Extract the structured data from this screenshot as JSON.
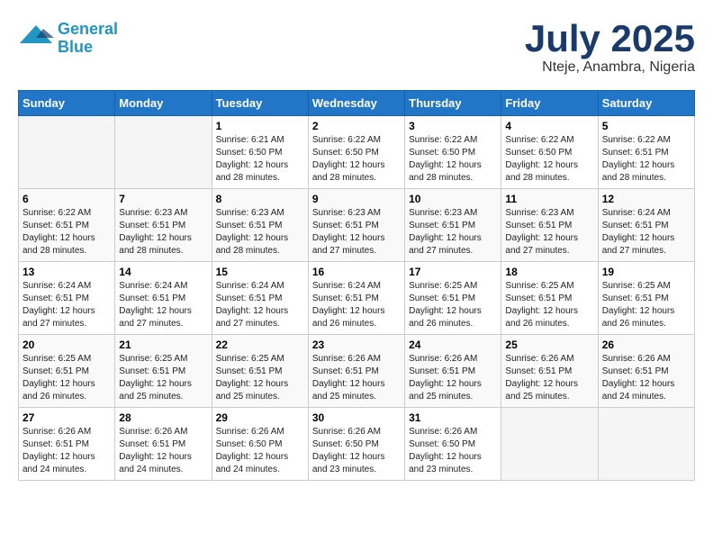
{
  "header": {
    "logo_line1": "General",
    "logo_line2": "Blue",
    "month": "July 2025",
    "location": "Nteje, Anambra, Nigeria"
  },
  "weekdays": [
    "Sunday",
    "Monday",
    "Tuesday",
    "Wednesday",
    "Thursday",
    "Friday",
    "Saturday"
  ],
  "weeks": [
    [
      {
        "day": "",
        "sunrise": "",
        "sunset": "",
        "daylight": ""
      },
      {
        "day": "",
        "sunrise": "",
        "sunset": "",
        "daylight": ""
      },
      {
        "day": "1",
        "sunrise": "Sunrise: 6:21 AM",
        "sunset": "Sunset: 6:50 PM",
        "daylight": "Daylight: 12 hours and 28 minutes."
      },
      {
        "day": "2",
        "sunrise": "Sunrise: 6:22 AM",
        "sunset": "Sunset: 6:50 PM",
        "daylight": "Daylight: 12 hours and 28 minutes."
      },
      {
        "day": "3",
        "sunrise": "Sunrise: 6:22 AM",
        "sunset": "Sunset: 6:50 PM",
        "daylight": "Daylight: 12 hours and 28 minutes."
      },
      {
        "day": "4",
        "sunrise": "Sunrise: 6:22 AM",
        "sunset": "Sunset: 6:50 PM",
        "daylight": "Daylight: 12 hours and 28 minutes."
      },
      {
        "day": "5",
        "sunrise": "Sunrise: 6:22 AM",
        "sunset": "Sunset: 6:51 PM",
        "daylight": "Daylight: 12 hours and 28 minutes."
      }
    ],
    [
      {
        "day": "6",
        "sunrise": "Sunrise: 6:22 AM",
        "sunset": "Sunset: 6:51 PM",
        "daylight": "Daylight: 12 hours and 28 minutes."
      },
      {
        "day": "7",
        "sunrise": "Sunrise: 6:23 AM",
        "sunset": "Sunset: 6:51 PM",
        "daylight": "Daylight: 12 hours and 28 minutes."
      },
      {
        "day": "8",
        "sunrise": "Sunrise: 6:23 AM",
        "sunset": "Sunset: 6:51 PM",
        "daylight": "Daylight: 12 hours and 28 minutes."
      },
      {
        "day": "9",
        "sunrise": "Sunrise: 6:23 AM",
        "sunset": "Sunset: 6:51 PM",
        "daylight": "Daylight: 12 hours and 27 minutes."
      },
      {
        "day": "10",
        "sunrise": "Sunrise: 6:23 AM",
        "sunset": "Sunset: 6:51 PM",
        "daylight": "Daylight: 12 hours and 27 minutes."
      },
      {
        "day": "11",
        "sunrise": "Sunrise: 6:23 AM",
        "sunset": "Sunset: 6:51 PM",
        "daylight": "Daylight: 12 hours and 27 minutes."
      },
      {
        "day": "12",
        "sunrise": "Sunrise: 6:24 AM",
        "sunset": "Sunset: 6:51 PM",
        "daylight": "Daylight: 12 hours and 27 minutes."
      }
    ],
    [
      {
        "day": "13",
        "sunrise": "Sunrise: 6:24 AM",
        "sunset": "Sunset: 6:51 PM",
        "daylight": "Daylight: 12 hours and 27 minutes."
      },
      {
        "day": "14",
        "sunrise": "Sunrise: 6:24 AM",
        "sunset": "Sunset: 6:51 PM",
        "daylight": "Daylight: 12 hours and 27 minutes."
      },
      {
        "day": "15",
        "sunrise": "Sunrise: 6:24 AM",
        "sunset": "Sunset: 6:51 PM",
        "daylight": "Daylight: 12 hours and 27 minutes."
      },
      {
        "day": "16",
        "sunrise": "Sunrise: 6:24 AM",
        "sunset": "Sunset: 6:51 PM",
        "daylight": "Daylight: 12 hours and 26 minutes."
      },
      {
        "day": "17",
        "sunrise": "Sunrise: 6:25 AM",
        "sunset": "Sunset: 6:51 PM",
        "daylight": "Daylight: 12 hours and 26 minutes."
      },
      {
        "day": "18",
        "sunrise": "Sunrise: 6:25 AM",
        "sunset": "Sunset: 6:51 PM",
        "daylight": "Daylight: 12 hours and 26 minutes."
      },
      {
        "day": "19",
        "sunrise": "Sunrise: 6:25 AM",
        "sunset": "Sunset: 6:51 PM",
        "daylight": "Daylight: 12 hours and 26 minutes."
      }
    ],
    [
      {
        "day": "20",
        "sunrise": "Sunrise: 6:25 AM",
        "sunset": "Sunset: 6:51 PM",
        "daylight": "Daylight: 12 hours and 26 minutes."
      },
      {
        "day": "21",
        "sunrise": "Sunrise: 6:25 AM",
        "sunset": "Sunset: 6:51 PM",
        "daylight": "Daylight: 12 hours and 25 minutes."
      },
      {
        "day": "22",
        "sunrise": "Sunrise: 6:25 AM",
        "sunset": "Sunset: 6:51 PM",
        "daylight": "Daylight: 12 hours and 25 minutes."
      },
      {
        "day": "23",
        "sunrise": "Sunrise: 6:26 AM",
        "sunset": "Sunset: 6:51 PM",
        "daylight": "Daylight: 12 hours and 25 minutes."
      },
      {
        "day": "24",
        "sunrise": "Sunrise: 6:26 AM",
        "sunset": "Sunset: 6:51 PM",
        "daylight": "Daylight: 12 hours and 25 minutes."
      },
      {
        "day": "25",
        "sunrise": "Sunrise: 6:26 AM",
        "sunset": "Sunset: 6:51 PM",
        "daylight": "Daylight: 12 hours and 25 minutes."
      },
      {
        "day": "26",
        "sunrise": "Sunrise: 6:26 AM",
        "sunset": "Sunset: 6:51 PM",
        "daylight": "Daylight: 12 hours and 24 minutes."
      }
    ],
    [
      {
        "day": "27",
        "sunrise": "Sunrise: 6:26 AM",
        "sunset": "Sunset: 6:51 PM",
        "daylight": "Daylight: 12 hours and 24 minutes."
      },
      {
        "day": "28",
        "sunrise": "Sunrise: 6:26 AM",
        "sunset": "Sunset: 6:51 PM",
        "daylight": "Daylight: 12 hours and 24 minutes."
      },
      {
        "day": "29",
        "sunrise": "Sunrise: 6:26 AM",
        "sunset": "Sunset: 6:50 PM",
        "daylight": "Daylight: 12 hours and 24 minutes."
      },
      {
        "day": "30",
        "sunrise": "Sunrise: 6:26 AM",
        "sunset": "Sunset: 6:50 PM",
        "daylight": "Daylight: 12 hours and 23 minutes."
      },
      {
        "day": "31",
        "sunrise": "Sunrise: 6:26 AM",
        "sunset": "Sunset: 6:50 PM",
        "daylight": "Daylight: 12 hours and 23 minutes."
      },
      {
        "day": "",
        "sunrise": "",
        "sunset": "",
        "daylight": ""
      },
      {
        "day": "",
        "sunrise": "",
        "sunset": "",
        "daylight": ""
      }
    ]
  ]
}
